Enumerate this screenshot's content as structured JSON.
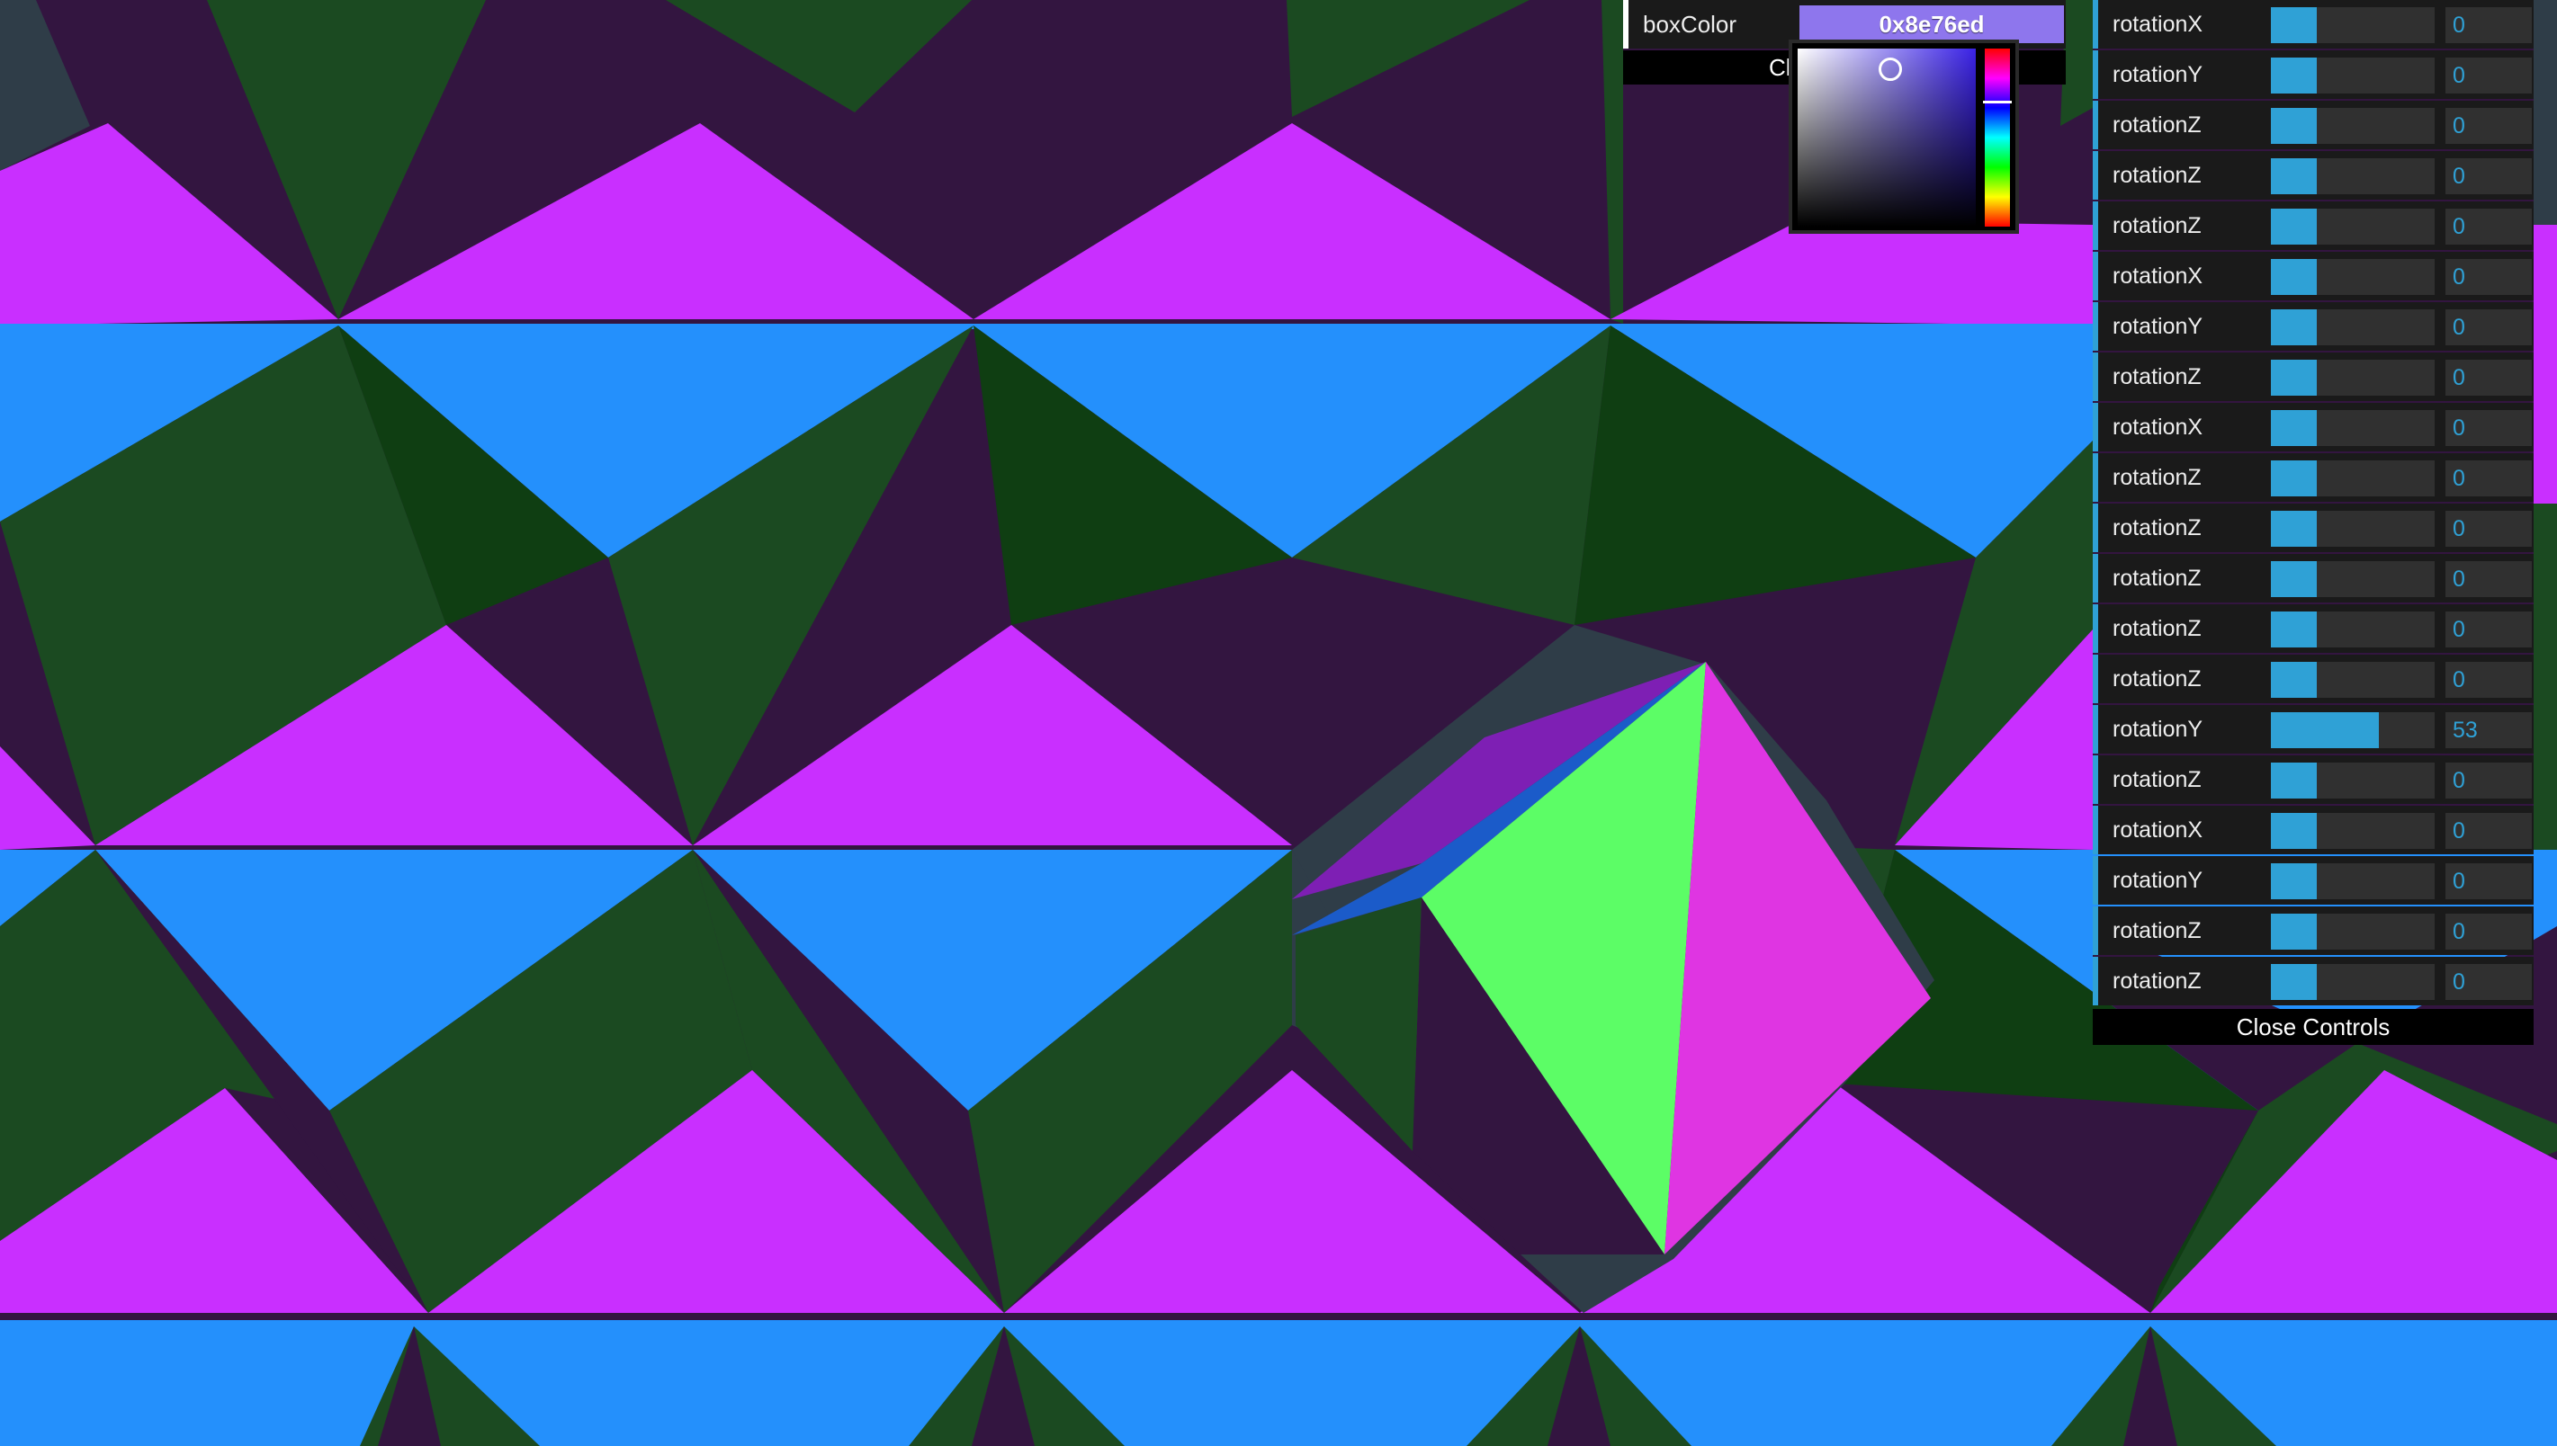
{
  "colors": {
    "magenta": "#c92fff",
    "blue": "#2490fc",
    "green": "#1b4a21",
    "green_dark": "#0f3e12",
    "purple_dark": "#331540",
    "slate": "#2f3d48",
    "shape_green": "#5cfd66",
    "shape_pink": "#df35e2",
    "shape_violet": "#7e1fb4",
    "shape_blue": "#1b5bc9",
    "gui_accent": "#2fa1d6"
  },
  "color_picker": {
    "label": "boxColor",
    "value": "0x8e76ed",
    "swatch_color": "#8e76ed",
    "close_label_partial": "Cl"
  },
  "gui": {
    "controls": [
      {
        "label": "rotationX",
        "value": "0",
        "fraction": 0.28
      },
      {
        "label": "rotationY",
        "value": "0",
        "fraction": 0.28
      },
      {
        "label": "rotationZ",
        "value": "0",
        "fraction": 0.28
      },
      {
        "label": "rotationZ",
        "value": "0",
        "fraction": 0.28
      },
      {
        "label": "rotationZ",
        "value": "0",
        "fraction": 0.28
      },
      {
        "label": "rotationX",
        "value": "0",
        "fraction": 0.28
      },
      {
        "label": "rotationY",
        "value": "0",
        "fraction": 0.28
      },
      {
        "label": "rotationZ",
        "value": "0",
        "fraction": 0.28
      },
      {
        "label": "rotationX",
        "value": "0",
        "fraction": 0.28
      },
      {
        "label": "rotationZ",
        "value": "0",
        "fraction": 0.28
      },
      {
        "label": "rotationZ",
        "value": "0",
        "fraction": 0.28
      },
      {
        "label": "rotationZ",
        "value": "0",
        "fraction": 0.28
      },
      {
        "label": "rotationZ",
        "value": "0",
        "fraction": 0.28
      },
      {
        "label": "rotationZ",
        "value": "0",
        "fraction": 0.28
      },
      {
        "label": "rotationY",
        "value": "53",
        "fraction": 0.66
      },
      {
        "label": "rotationZ",
        "value": "0",
        "fraction": 0.28
      },
      {
        "label": "rotationX",
        "value": "0",
        "fraction": 0.28
      },
      {
        "label": "rotationY",
        "value": "0",
        "fraction": 0.28
      },
      {
        "label": "rotationZ",
        "value": "0",
        "fraction": 0.28
      },
      {
        "label": "rotationZ",
        "value": "0",
        "fraction": 0.28
      }
    ],
    "close_label": "Close Controls"
  }
}
